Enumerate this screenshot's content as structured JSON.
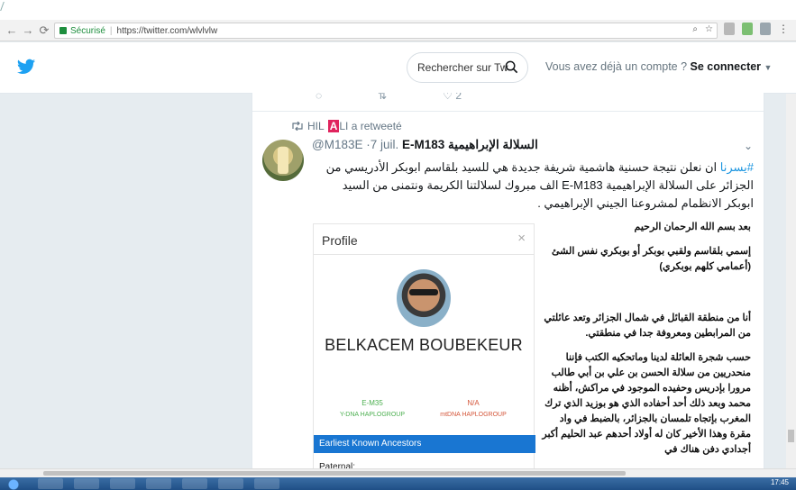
{
  "browser": {
    "secure_label": "Sécurisé",
    "url": "https://twitter.com/wlvlvlw",
    "back_icon": "back-arrow-icon",
    "forward_icon": "forward-arrow-icon",
    "reload_icon": "reload-icon"
  },
  "header": {
    "search_placeholder": "Rechercher sur Tw",
    "login_prompt": "Vous avez déjà un compte ?",
    "login_link": "Se connecter",
    "brand_color": "#1da1f2"
  },
  "previous_tweet": {
    "like_count": "2"
  },
  "tweet": {
    "retweeter_pre": "HIL",
    "retweeter_mark": "A",
    "retweeter_post": "LI a retweeté",
    "display_name": "السلالة الإبراهيمية E-M183",
    "handle_date": "@M183E ·7 juil.",
    "hashtag": "#يسرنا",
    "text": " ان نعلن نتيجة حسنية هاشمية شريفة جديدة هي للسيد بلقاسم ابوبكر الأدريسي من الجزائر على السلالة الإبراهيمية E-M183 الف مبروك لسلالتنا الكريمة ونتمنى من السيد ابوبكر الانظمام لمشروعنا الجيني الإبراهيمي ."
  },
  "embed": {
    "profile_title": "Profile",
    "close_symbol": "×",
    "person_name": "BELKACEM BOUBEKEUR",
    "ydna_value": "E-M35",
    "ydna_label": "Y-DNA HAPLOGROUP",
    "mtdna_value": "N/A",
    "mtdna_label": "mtDNA HAPLOGROUP",
    "ancestors_header": "Earliest Known Ancestors",
    "paternal_label": "Paternal:",
    "arabic_p1": "بعد بسم الله الرحمان الرحيم",
    "arabic_p2": "إسمي بلقاسم ولقبي بوبكر أو بوبكري نفس الشئ (أعمامي كلهم بوبكري)",
    "arabic_p3": "أنا من منطقة القبائل في شمال الجزائر وتعد عائلتي من المرابطين ومعروفة جدا في منطقتي.",
    "arabic_p4": "حسب شجرة العائلة لدينا وماتحكيه الكتب فإننا منحدريين من سلالة الحسن بن علي بن أبي طالب مرورا بإدريس وحفيده الموجود في مراكش، أظنه محمد وبعد ذلك أحد أحفاده الذي هو بوزيد الذي ترك المغرب بإتجاه تلمسان بالجزائر، بالضبط في واد مقرة وهذا الأخير كان له أولاد أحدهم عبد الحليم أكبر أجدادي دفن هناك في"
  },
  "taskbar": {
    "clock": "17:45"
  }
}
